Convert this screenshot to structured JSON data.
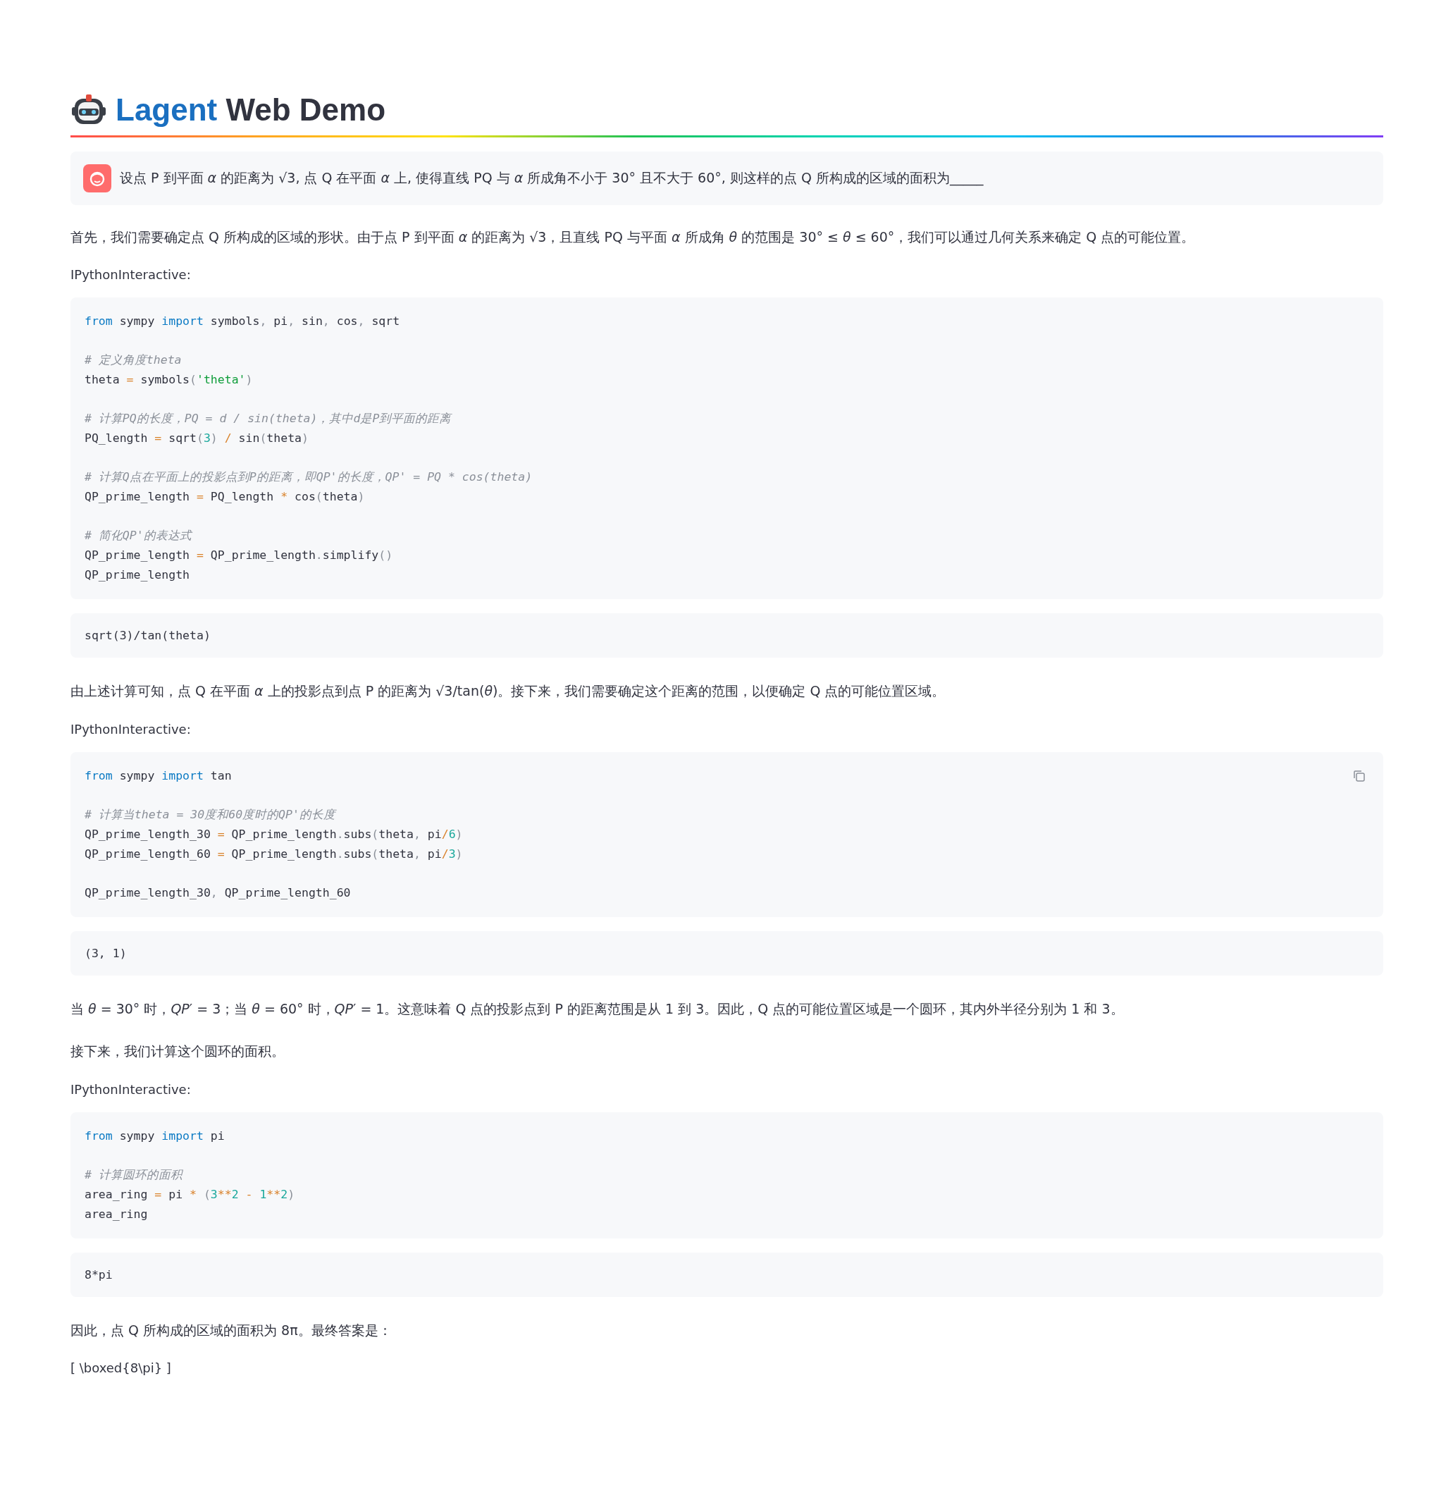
{
  "header": {
    "title_accent": "Lagent",
    "title_rest": "Web Demo"
  },
  "question": "设点 P 到平面 *α* 的距离为 √3, 点 Q 在平面 *α* 上, 使得直线 PQ 与 *α* 所成角不小于 30° 且不大于 60°, 则这样的点 Q 所构成的区域的面积为_____",
  "blocks": [
    {
      "kind": "text",
      "text": "首先，我们需要确定点 Q 所构成的区域的形状。由于点 P 到平面 *α* 的距离为 √3，且直线 PQ 与平面 *α* 所成角 *θ* 的范围是 30° ≤ *θ* ≤ 60°，我们可以通过几何关系来确定 Q 点的可能位置。"
    },
    {
      "kind": "label",
      "text": "IPythonInteractive:"
    },
    {
      "kind": "code",
      "show_copy": false,
      "groups": [
        [
          [
            {
              "kind": "kw",
              "text": "from"
            },
            {
              "kind": "plain",
              "text": " sympy "
            },
            {
              "kind": "kw",
              "text": "import"
            },
            {
              "kind": "plain",
              "text": " symbols"
            },
            {
              "kind": "punct",
              "text": ", "
            },
            {
              "kind": "plain",
              "text": "pi"
            },
            {
              "kind": "punct",
              "text": ", "
            },
            {
              "kind": "plain",
              "text": "sin"
            },
            {
              "kind": "punct",
              "text": ", "
            },
            {
              "kind": "plain",
              "text": "cos"
            },
            {
              "kind": "punct",
              "text": ", "
            },
            {
              "kind": "plain",
              "text": "sqrt"
            }
          ]
        ],
        [
          [
            {
              "kind": "comment",
              "text": "# 定义角度theta"
            }
          ],
          [
            {
              "kind": "plain",
              "text": "theta "
            },
            {
              "kind": "op",
              "text": "="
            },
            {
              "kind": "plain",
              "text": " symbols"
            },
            {
              "kind": "punct",
              "text": "("
            },
            {
              "kind": "str",
              "text": "'theta'"
            },
            {
              "kind": "punct",
              "text": ")"
            }
          ]
        ],
        [
          [
            {
              "kind": "comment",
              "text": "# 计算PQ的长度，PQ = d / sin(theta)，其中d是P到平面的距离"
            }
          ],
          [
            {
              "kind": "plain",
              "text": "PQ_length "
            },
            {
              "kind": "op",
              "text": "="
            },
            {
              "kind": "plain",
              "text": " sqrt"
            },
            {
              "kind": "punct",
              "text": "("
            },
            {
              "kind": "num",
              "text": "3"
            },
            {
              "kind": "punct",
              "text": ") "
            },
            {
              "kind": "op",
              "text": "/"
            },
            {
              "kind": "plain",
              "text": " sin"
            },
            {
              "kind": "punct",
              "text": "("
            },
            {
              "kind": "plain",
              "text": "theta"
            },
            {
              "kind": "punct",
              "text": ")"
            }
          ]
        ],
        [
          [
            {
              "kind": "comment",
              "text": "# 计算Q点在平面上的投影点到P的距离，即QP'的长度，QP' = PQ * cos(theta)"
            }
          ],
          [
            {
              "kind": "plain",
              "text": "QP_prime_length "
            },
            {
              "kind": "op",
              "text": "="
            },
            {
              "kind": "plain",
              "text": " PQ_length "
            },
            {
              "kind": "op",
              "text": "*"
            },
            {
              "kind": "plain",
              "text": " cos"
            },
            {
              "kind": "punct",
              "text": "("
            },
            {
              "kind": "plain",
              "text": "theta"
            },
            {
              "kind": "punct",
              "text": ")"
            }
          ]
        ],
        [
          [
            {
              "kind": "comment",
              "text": "# 简化QP'的表达式"
            }
          ],
          [
            {
              "kind": "plain",
              "text": "QP_prime_length "
            },
            {
              "kind": "op",
              "text": "="
            },
            {
              "kind": "plain",
              "text": " QP_prime_length"
            },
            {
              "kind": "punct",
              "text": "."
            },
            {
              "kind": "plain",
              "text": "simplify"
            },
            {
              "kind": "punct",
              "text": "()"
            }
          ],
          [
            {
              "kind": "plain",
              "text": "QP_prime_length"
            }
          ]
        ]
      ]
    },
    {
      "kind": "output",
      "text": "sqrt(3)/tan(theta)"
    },
    {
      "kind": "text",
      "text": "由上述计算可知，点 Q 在平面 *α* 上的投影点到点 P 的距离为 √3/tan(*θ*)。接下来，我们需要确定这个距离的范围，以便确定 Q 点的可能位置区域。"
    },
    {
      "kind": "label",
      "text": "IPythonInteractive:"
    },
    {
      "kind": "code",
      "show_copy": true,
      "groups": [
        [
          [
            {
              "kind": "kw",
              "text": "from"
            },
            {
              "kind": "plain",
              "text": " sympy "
            },
            {
              "kind": "kw",
              "text": "import"
            },
            {
              "kind": "plain",
              "text": " tan"
            }
          ]
        ],
        [
          [
            {
              "kind": "comment",
              "text": "# 计算当theta = 30度和60度时的QP'的长度"
            }
          ],
          [
            {
              "kind": "plain",
              "text": "QP_prime_length_30 "
            },
            {
              "kind": "op",
              "text": "="
            },
            {
              "kind": "plain",
              "text": " QP_prime_length"
            },
            {
              "kind": "punct",
              "text": "."
            },
            {
              "kind": "plain",
              "text": "subs"
            },
            {
              "kind": "punct",
              "text": "("
            },
            {
              "kind": "plain",
              "text": "theta"
            },
            {
              "kind": "punct",
              "text": ", "
            },
            {
              "kind": "plain",
              "text": "pi"
            },
            {
              "kind": "op",
              "text": "/"
            },
            {
              "kind": "num",
              "text": "6"
            },
            {
              "kind": "punct",
              "text": ")"
            }
          ],
          [
            {
              "kind": "plain",
              "text": "QP_prime_length_60 "
            },
            {
              "kind": "op",
              "text": "="
            },
            {
              "kind": "plain",
              "text": " QP_prime_length"
            },
            {
              "kind": "punct",
              "text": "."
            },
            {
              "kind": "plain",
              "text": "subs"
            },
            {
              "kind": "punct",
              "text": "("
            },
            {
              "kind": "plain",
              "text": "theta"
            },
            {
              "kind": "punct",
              "text": ", "
            },
            {
              "kind": "plain",
              "text": "pi"
            },
            {
              "kind": "op",
              "text": "/"
            },
            {
              "kind": "num",
              "text": "3"
            },
            {
              "kind": "punct",
              "text": ")"
            }
          ]
        ],
        [
          [
            {
              "kind": "plain",
              "text": "QP_prime_length_30"
            },
            {
              "kind": "punct",
              "text": ", "
            },
            {
              "kind": "plain",
              "text": "QP_prime_length_60"
            }
          ]
        ]
      ]
    },
    {
      "kind": "output",
      "text": "(3, 1)"
    },
    {
      "kind": "text",
      "text": "当 *θ* = 30° 时，*QP*′ = 3；当 *θ* = 60° 时，*QP*′ = 1。这意味着 Q 点的投影点到 P 的距离范围是从 1 到 3。因此，Q 点的可能位置区域是一个圆环，其内外半径分别为 1 和 3。"
    },
    {
      "kind": "text",
      "text": "接下来，我们计算这个圆环的面积。"
    },
    {
      "kind": "label",
      "text": "IPythonInteractive:"
    },
    {
      "kind": "code",
      "show_copy": false,
      "groups": [
        [
          [
            {
              "kind": "kw",
              "text": "from"
            },
            {
              "kind": "plain",
              "text": " sympy "
            },
            {
              "kind": "kw",
              "text": "import"
            },
            {
              "kind": "plain",
              "text": " pi"
            }
          ]
        ],
        [
          [
            {
              "kind": "comment",
              "text": "# 计算圆环的面积"
            }
          ],
          [
            {
              "kind": "plain",
              "text": "area_ring "
            },
            {
              "kind": "op",
              "text": "="
            },
            {
              "kind": "plain",
              "text": " pi "
            },
            {
              "kind": "op",
              "text": "*"
            },
            {
              "kind": "punct",
              "text": " ("
            },
            {
              "kind": "num",
              "text": "3"
            },
            {
              "kind": "op",
              "text": "**"
            },
            {
              "kind": "num",
              "text": "2"
            },
            {
              "kind": "op",
              "text": " - "
            },
            {
              "kind": "num",
              "text": "1"
            },
            {
              "kind": "op",
              "text": "**"
            },
            {
              "kind": "num",
              "text": "2"
            },
            {
              "kind": "punct",
              "text": ")"
            }
          ],
          [
            {
              "kind": "plain",
              "text": "area_ring"
            }
          ]
        ]
      ]
    },
    {
      "kind": "output",
      "text": "8*pi"
    },
    {
      "kind": "text",
      "text": "因此，点 Q 所构成的区域的面积为 8π。最终答案是："
    },
    {
      "kind": "label",
      "text": "[ \\boxed{8\\pi} ]"
    }
  ]
}
